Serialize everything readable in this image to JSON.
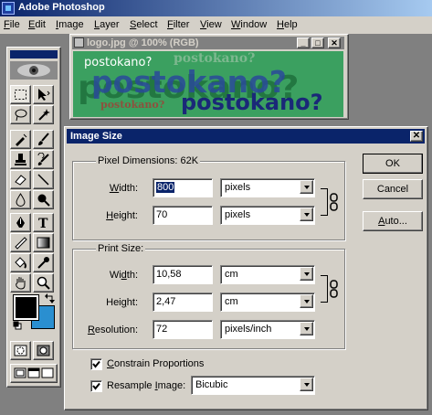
{
  "app": {
    "title": "Adobe Photoshop"
  },
  "menu": [
    {
      "label": "File",
      "key": "F",
      "rest": "ile"
    },
    {
      "label": "Edit",
      "key": "E",
      "rest": "dit"
    },
    {
      "label": "Image",
      "key": "I",
      "rest": "mage"
    },
    {
      "label": "Layer",
      "key": "L",
      "rest": "ayer"
    },
    {
      "label": "Select",
      "key": "S",
      "rest": "elect"
    },
    {
      "label": "Filter",
      "key": "F",
      "rest": "ilter"
    },
    {
      "label": "View",
      "key": "V",
      "rest": "iew"
    },
    {
      "label": "Window",
      "key": "W",
      "rest": "indow"
    },
    {
      "label": "Help",
      "key": "H",
      "rest": "elp"
    }
  ],
  "document": {
    "title": "logo.jpg @ 100% (RGB)",
    "canvas_texts": [
      "postokano?",
      "postokano?",
      "postokano?",
      "postokano?",
      "postokano?",
      "postokano?"
    ]
  },
  "dialog": {
    "title": "Image Size",
    "pixel_dimensions": {
      "legend": "Pixel Dimensions:  62K",
      "width_label_key": "W",
      "width_label_rest": "idth:",
      "width_value": "800",
      "width_unit": "pixels",
      "height_label_key": "H",
      "height_label_rest": "eight:",
      "height_value": "70",
      "height_unit": "pixels"
    },
    "print_size": {
      "legend": "Print Size:",
      "width_label_pre": "Wi",
      "width_label_key": "d",
      "width_label_rest": "th:",
      "width_value": "10,58",
      "width_unit": "cm",
      "height_label_pre": "Hei",
      "height_label_key": "g",
      "height_label_rest": "ht:",
      "height_value": "2,47",
      "height_unit": "cm",
      "resolution_label_key": "R",
      "resolution_label_rest": "esolution:",
      "resolution_value": "72",
      "resolution_unit": "pixels/inch"
    },
    "constrain": {
      "label_key": "C",
      "label_rest": "onstrain Proportions",
      "checked": true
    },
    "resample": {
      "label_pre": "Resample ",
      "label_key": "I",
      "label_rest": "mage:",
      "checked": true,
      "method": "Bicubic"
    },
    "buttons": {
      "ok": "OK",
      "cancel": "Cancel",
      "auto_key": "A",
      "auto_rest": "uto..."
    }
  },
  "colors": {
    "title_active": "#0a246a",
    "face": "#d4d0c8",
    "canvas": "#3ba060",
    "foreground": "#000000",
    "background": "#2a8fd0"
  }
}
